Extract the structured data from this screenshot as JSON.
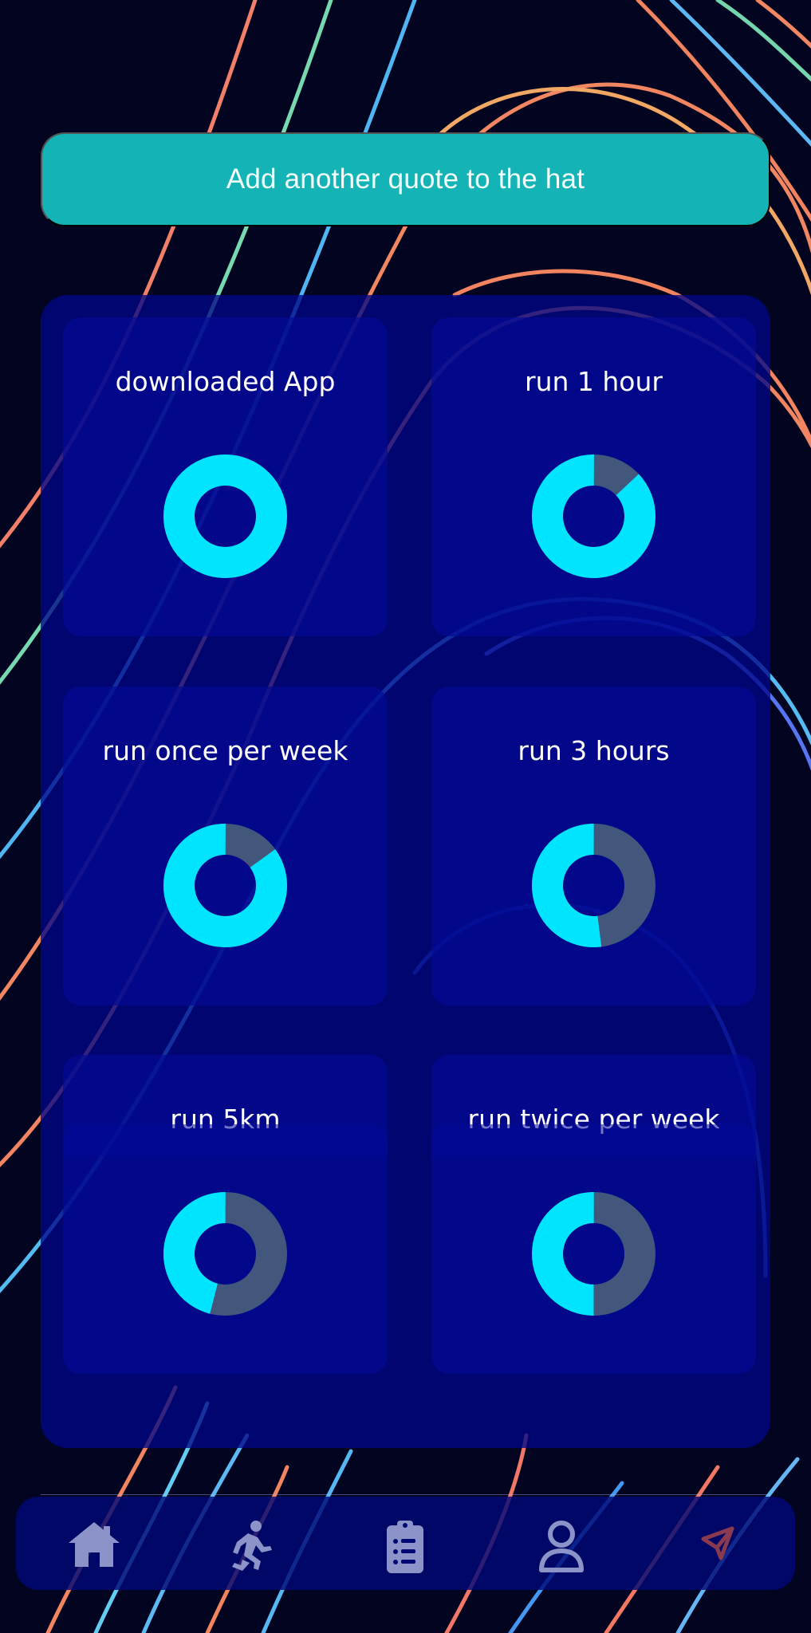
{
  "add_quote_button": {
    "label": "Add another quote to the hat"
  },
  "achievements": [
    {
      "label": "downloaded App",
      "progress": 1.0
    },
    {
      "label": "run 1 hour",
      "progress": 0.87
    },
    {
      "label": "run once per week",
      "progress": 0.85
    },
    {
      "label": "run 3 hours",
      "progress": 0.52
    },
    {
      "label": "run 5km",
      "progress": 0.46
    },
    {
      "label": "run twice per week",
      "progress": 0.5
    }
  ],
  "navigation": {
    "items": [
      {
        "icon": "home-icon",
        "active": true
      },
      {
        "icon": "runner-icon",
        "active": false
      },
      {
        "icon": "clipboard-icon",
        "active": false
      },
      {
        "icon": "profile-icon",
        "active": false
      },
      {
        "icon": "send-icon",
        "active": false
      }
    ]
  },
  "colors": {
    "background": "#03041f",
    "button": "#14b3b6",
    "panel": "#000687",
    "card": "#030a97",
    "ring_complete": "#00e5ff",
    "ring_remaining": "#42577b",
    "nav_icon": "#8c93c8",
    "send_icon": "#8a3a4f"
  }
}
